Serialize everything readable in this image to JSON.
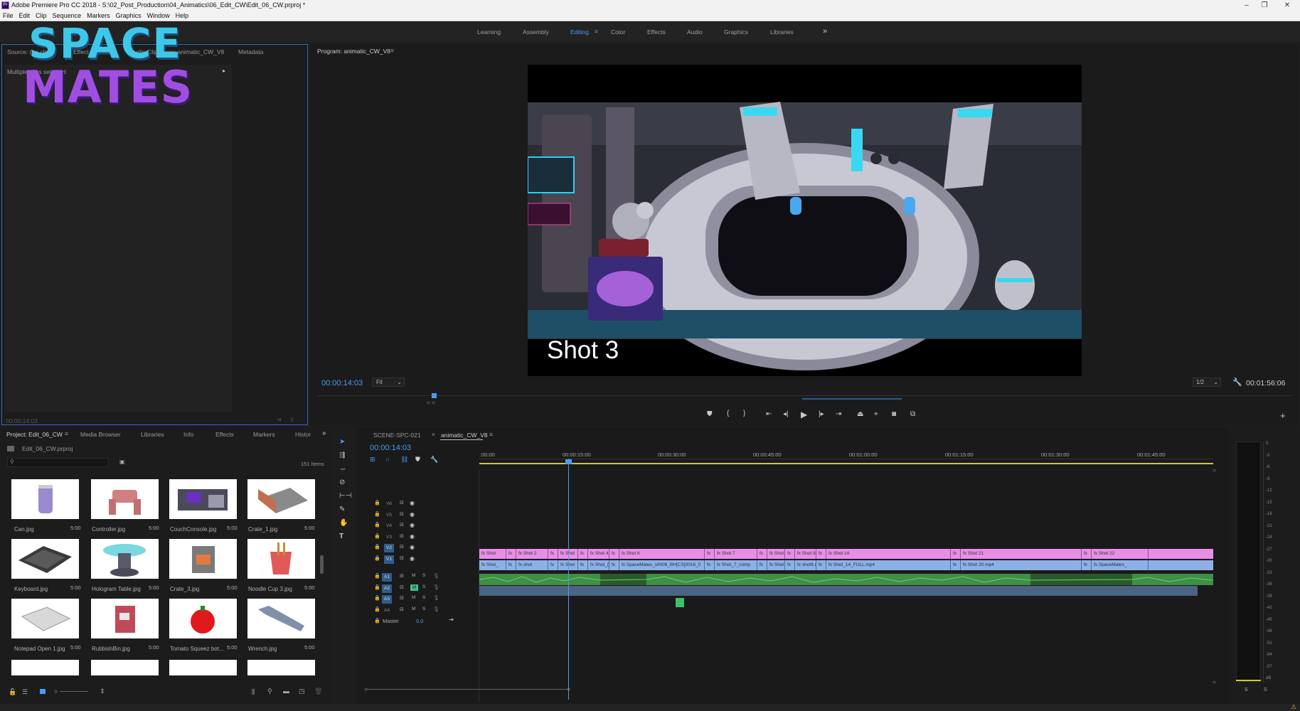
{
  "titlebar": {
    "title": "Adobe Premiere Pro CC 2018 - S:\\02_Post_Production\\04_Animatics\\06_Edit_CW\\Edit_06_CW.prproj *",
    "icon": "Pr"
  },
  "menu": [
    "File",
    "Edit",
    "Clip",
    "Sequence",
    "Markers",
    "Graphics",
    "Window",
    "Help"
  ],
  "workspaces": [
    "Learning",
    "Assembly",
    "Editing",
    "Color",
    "Effects",
    "Audio",
    "Graphics",
    "Libraries"
  ],
  "active_workspace": "Editing",
  "overlay_logo": {
    "line1": "SPACE",
    "line2": "MATES"
  },
  "source_panel": {
    "tabs": [
      "Source: (no clips)",
      "Effect Controls",
      "Audio Clip Mixer: animatic_CW_V8",
      "Metadata"
    ],
    "message": "Multiple clips selected",
    "timecode": "00:00:14:03"
  },
  "program": {
    "tab": "Program: animatic_CW_V8",
    "timecode": "00:00:14:03",
    "fit": "Fit",
    "resolution": "1/2",
    "duration": "00:01:56:06",
    "overlay_text": "Shot 3",
    "playhead_fraction": 0.12
  },
  "project": {
    "tabs": [
      "Project: Edit_06_CW",
      "Media Browser",
      "Libraries",
      "Info",
      "Effects",
      "Markers",
      "Histor"
    ],
    "filename": "Edit_06_CW.prproj",
    "item_count": "151 Items",
    "items": [
      {
        "name": "Can.jpg",
        "dur": "5:00"
      },
      {
        "name": "Controller.jpg",
        "dur": "5:00"
      },
      {
        "name": "CouchConsole.jpg",
        "dur": "5:00"
      },
      {
        "name": "Crate_1.jpg",
        "dur": "5:00"
      },
      {
        "name": "Keyboard.jpg",
        "dur": "5:00"
      },
      {
        "name": "Hologram Table.jpg",
        "dur": "5:00"
      },
      {
        "name": "Crate_3.jpg",
        "dur": "5:00"
      },
      {
        "name": "Noodle Cup 3.jpg",
        "dur": "5:00"
      },
      {
        "name": "Notepad Open 1.jpg",
        "dur": "5:00"
      },
      {
        "name": "RubbishBin.jpg",
        "dur": "5:00"
      },
      {
        "name": "Tomato Squeez bot...",
        "dur": "5:00"
      },
      {
        "name": "Wrench.jpg",
        "dur": "5:00"
      }
    ]
  },
  "timeline": {
    "tabs": [
      "SCENE-SPC-021",
      "animatic_CW_V8"
    ],
    "timecode": "00:00:14:03",
    "ruler": [
      ":00:00",
      "00:00:15:00",
      "00:00:30:00",
      "00:00:45:00",
      "00:01:00:00",
      "00:01:15:00",
      "00:01:30:00",
      "00:01:45:00"
    ],
    "video_tracks": [
      "V6",
      "V5",
      "V4",
      "V3",
      "V2",
      "V1"
    ],
    "audio_tracks": [
      "A1",
      "A2",
      "A3",
      "A4"
    ],
    "master": {
      "label": "Master",
      "value": "0.0"
    },
    "v2_clips": [
      "Shot",
      "Shot 2",
      "Shot",
      "Shot 4",
      "Shot 6",
      "Shot 7",
      "Shot",
      "Shot 9",
      "Shot 14",
      "Shot 21",
      "Shot 22"
    ],
    "v1_clips": [
      "Shot_",
      "shot",
      "Shot",
      "Shot_(",
      "SpaceMates_s0006_BH[CS]0016_0",
      "Shot_7_comp",
      "Shot",
      "shot9.m",
      "Shot_14_FULL.mp4",
      "Shot 20.mp4",
      "SpaceMates_"
    ]
  },
  "meter": {
    "scale": [
      "0",
      "-3",
      "-6",
      "-9",
      "-12",
      "-15",
      "-18",
      "-21",
      "-24",
      "-27",
      "-30",
      "-33",
      "-36",
      "-39",
      "-42",
      "-45",
      "-48",
      "-51",
      "-54",
      "-57",
      "dB"
    ],
    "solo_labels": [
      "S",
      "S"
    ]
  },
  "colors": {
    "accent": "#4a9cf0",
    "v2_clip": "#e98de8",
    "v1_clip": "#8db1e6",
    "audio_clip": "#3f8f44",
    "ruler_bar": "#c8c83a"
  },
  "icons": [
    "search-icon",
    "new-bin-icon",
    "list-view-icon",
    "icon-view-icon",
    "zoom-slider-icon",
    "sort-icon",
    "find-icon",
    "new-item-icon",
    "trash-icon",
    "selection-tool-icon",
    "track-select-tool-icon",
    "ripple-edit-tool-icon",
    "razor-tool-icon",
    "slip-tool-icon",
    "pen-tool-icon",
    "hand-tool-icon",
    "type-tool-icon",
    "play-icon",
    "step-back-icon",
    "step-forward-icon",
    "export-frame-icon",
    "wrench-icon",
    "lock-icon",
    "eye-icon",
    "mic-icon"
  ]
}
